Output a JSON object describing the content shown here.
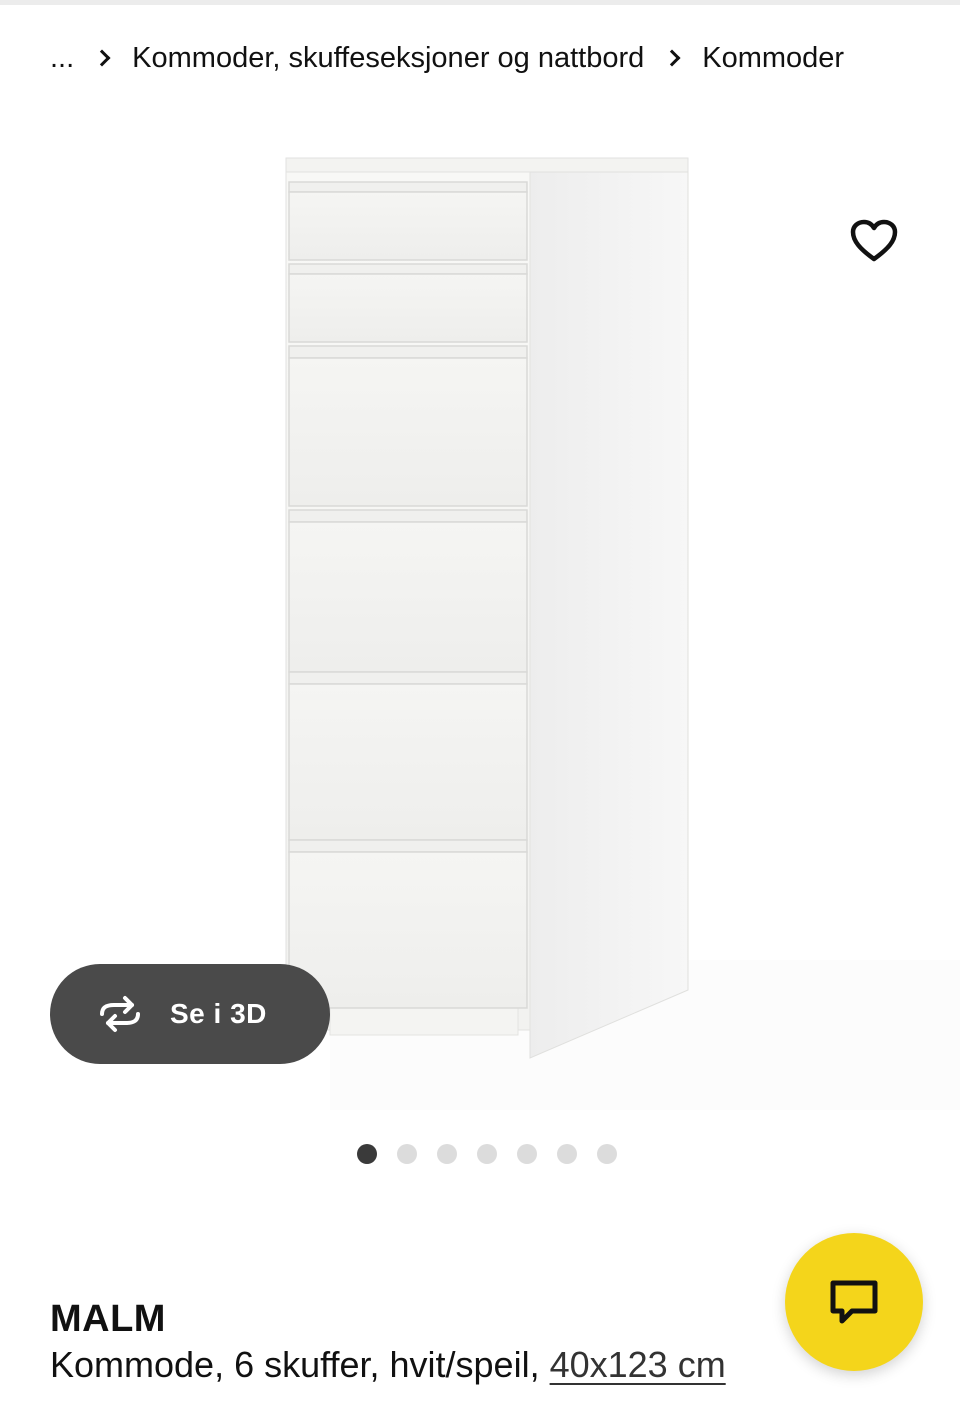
{
  "breadcrumb": {
    "ellipsis": "...",
    "items": [
      {
        "label": "Kommoder, skuffeseksjoner og nattbord"
      },
      {
        "label": "Kommoder"
      }
    ]
  },
  "gallery": {
    "view3d_label": "Se i 3D",
    "dot_count": 7,
    "active_index": 0
  },
  "product": {
    "name": "MALM",
    "description": "Kommode, 6 skuffer, hvit/speil,",
    "size": "40x123 cm"
  },
  "colors": {
    "chat_button": "#f4d51b",
    "view3d_button": "#4a4a4a",
    "dot_active": "#3a3a3a",
    "dot_inactive": "#dcdcdc"
  },
  "icons": {
    "favorite": "heart-outline-icon",
    "view3d": "rotate-3d-icon",
    "chat": "chat-bubble-icon",
    "separator": "chevron-right-icon"
  }
}
